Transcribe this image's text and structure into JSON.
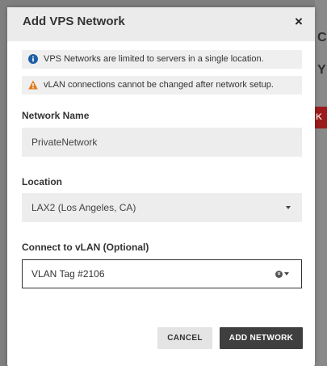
{
  "modal": {
    "title": "Add VPS Network",
    "close_label": "×"
  },
  "notices": [
    {
      "icon": "info-icon",
      "color": "#1f5fa6",
      "text": "VPS Networks are limited to servers in a single location."
    },
    {
      "icon": "warning-icon",
      "color": "#e07b1f",
      "text": "vLAN connections cannot be changed after network setup."
    }
  ],
  "form": {
    "network_name": {
      "label": "Network Name",
      "value": "PrivateNetwork"
    },
    "location": {
      "label": "Location",
      "value": "LAX2 (Los Angeles, CA)"
    },
    "vlan": {
      "label": "Connect to vLAN (Optional)",
      "value": "VLAN Tag #2106"
    }
  },
  "buttons": {
    "cancel": "CANCEL",
    "add": "ADD NETWORK"
  },
  "background": {
    "char1": "C",
    "char2": "Y",
    "red_button_text": "K"
  },
  "colors": {
    "primary_button": "#3f3f3f",
    "accent_red": "#9b1b1b"
  }
}
